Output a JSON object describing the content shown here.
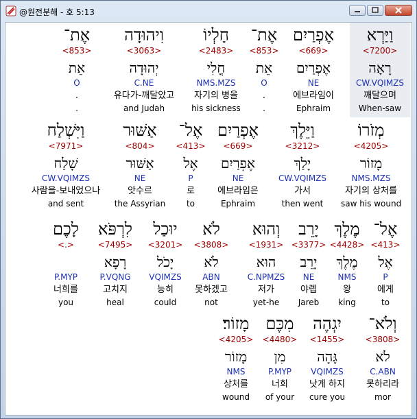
{
  "window": {
    "title": "@원전분해 - 호 5:13"
  },
  "colors": {
    "strongs": "#a00000",
    "grammar": "#1c2fb4",
    "selected_bg": "#e9ecf0"
  },
  "verse_rows": [
    [
      {
        "heb": "וַיַּרְא",
        "num": "<7200>",
        "lex": "רָאָה",
        "gram": "CW.VQIMZS",
        "kor": "깨달으며",
        "eng": "When-saw",
        "selected": true
      },
      {
        "heb": "אֶפְרַיִם",
        "num": "<669>",
        "lex": "אֶפְרַיִם",
        "gram": "NE",
        "kor": "에브라임이",
        "eng": "Ephraim"
      },
      {
        "heb": "אֶת־",
        "num": "<853>",
        "lex": "אֵת",
        "gram": "O",
        "kor": ".",
        "eng": "."
      },
      {
        "heb": "חָלְיוֹ",
        "num": "<2483>",
        "lex": "חֳלִי",
        "gram": "NMS.MZS",
        "kor": "자기의 병을",
        "eng": "his sickness"
      },
      {
        "heb": "וִיהוּדָה",
        "num": "<3063>",
        "lex": "יְהוּדָה",
        "gram": "C.NE",
        "kor": "유다가-깨달았고",
        "eng": "and Judah"
      },
      {
        "heb": "אֶת־",
        "num": "<853>",
        "lex": "אֵת",
        "gram": "O",
        "kor": ".",
        "eng": "."
      }
    ],
    [
      {
        "heb": "מְזֹרוֹ",
        "num": "<4205>",
        "lex": "מָזוֹר",
        "gram": "NMS.MZS",
        "kor": "자기의 상처를",
        "eng": "saw his wound"
      },
      {
        "heb": "וַיֵּלֶךְ",
        "num": "<3212>",
        "lex": "יָלַךְ",
        "gram": "CW.VQIMZS",
        "kor": "가서",
        "eng": "then went"
      },
      {
        "heb": "אֶפְרַיִם",
        "num": "<669>",
        "lex": "אֶפְרַיִם",
        "gram": "NE",
        "kor": "에브라임은",
        "eng": "Ephraim"
      },
      {
        "heb": "אֶל־",
        "num": "<413>",
        "lex": "אֶל",
        "gram": "P",
        "kor": "로",
        "eng": "to"
      },
      {
        "heb": "אַשּׁוּר",
        "num": "<804>",
        "lex": "אַשּׁוּר",
        "gram": "NE",
        "kor": "앗수르",
        "eng": "the Assyrian"
      },
      {
        "heb": "וַיִּשְׁלַח",
        "num": "<7971>",
        "lex": "שָׁלַח",
        "gram": "CW.VQIMZS",
        "kor": "사람을-보내었으나",
        "eng": "and sent"
      }
    ],
    [
      {
        "heb": "אֶל־",
        "num": "<413>",
        "lex": "אֶל",
        "gram": "P",
        "kor": "에게",
        "eng": "to"
      },
      {
        "heb": "מֶלֶךְ",
        "num": "<4428>",
        "lex": "מֶלֶךְ",
        "gram": "NMS",
        "kor": "왕",
        "eng": "king"
      },
      {
        "heb": "יָרֵב",
        "num": "<3377>",
        "lex": "יָרֵב",
        "gram": "NE",
        "kor": "야렙",
        "eng": "Jareb"
      },
      {
        "heb": "וְהוּא",
        "num": "<1931>",
        "lex": "הוּא",
        "gram": "C.NPMZS",
        "kor": "저가",
        "eng": "yet-he"
      },
      {
        "heb": "לֹא",
        "num": "<3808>",
        "lex": "לֹא",
        "gram": "ABN",
        "kor": "못하겠고",
        "eng": "not"
      },
      {
        "heb": "יוּכַל",
        "num": "<3201>",
        "lex": "יָכֹל",
        "gram": "VQIMZS",
        "kor": "능히",
        "eng": "could"
      },
      {
        "heb": "לִרְפֹּא",
        "num": "<7495>",
        "lex": "רָפָא",
        "gram": "P.VQNG",
        "kor": "고치지",
        "eng": "heal"
      },
      {
        "heb": "לָכֶם",
        "num": "<.>",
        "lex": "",
        "gram": "P.MYP",
        "kor": "너희를",
        "eng": "you"
      }
    ],
    [
      {
        "heb": "וְלֹא־",
        "num": "<3808>",
        "lex": "לֹא",
        "gram": "C.ABN",
        "kor": "못하리라",
        "eng": "mor"
      },
      {
        "heb": "יִגְהֶה",
        "num": "<1455>",
        "lex": "גָּהָה",
        "gram": "VQIMZS",
        "kor": "낫게 하지",
        "eng": "cure you"
      },
      {
        "heb": "מִכֶּם",
        "num": "<4480>",
        "lex": "מִן",
        "gram": "P.MYP",
        "kor": "너희",
        "eng": "of your"
      },
      {
        "heb": "מָזוֹר׃",
        "num": "<4205>",
        "lex": "מָזוֹר",
        "gram": "NMS",
        "kor": "상처를",
        "eng": "wound"
      }
    ]
  ]
}
